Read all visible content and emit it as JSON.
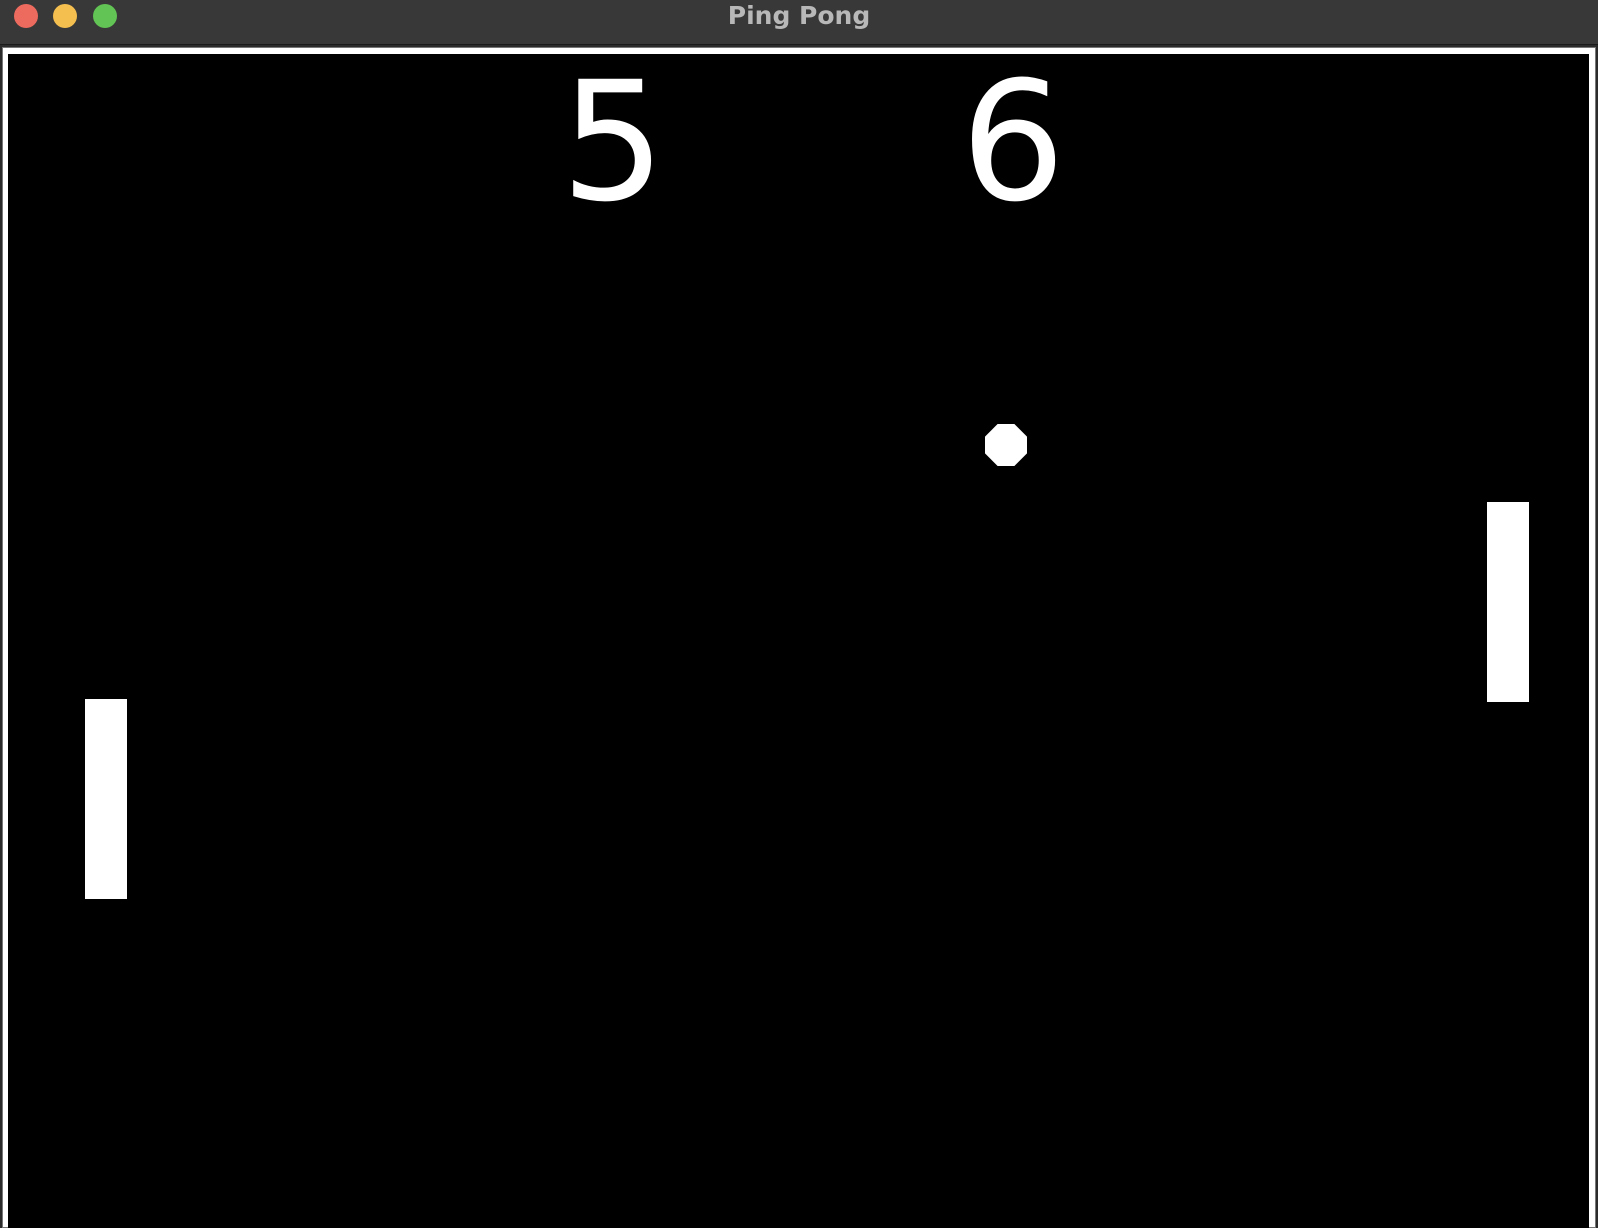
{
  "window": {
    "title": "Ping Pong",
    "controls": {
      "close": "close-icon",
      "minimize": "minimize-icon",
      "zoom": "zoom-icon"
    }
  },
  "game": {
    "background_color": "#000000",
    "foreground_color": "#ffffff",
    "score": {
      "left": "5",
      "right": "6"
    },
    "paddles": [
      "left-paddle",
      "right-paddle"
    ],
    "ball": "ball"
  }
}
